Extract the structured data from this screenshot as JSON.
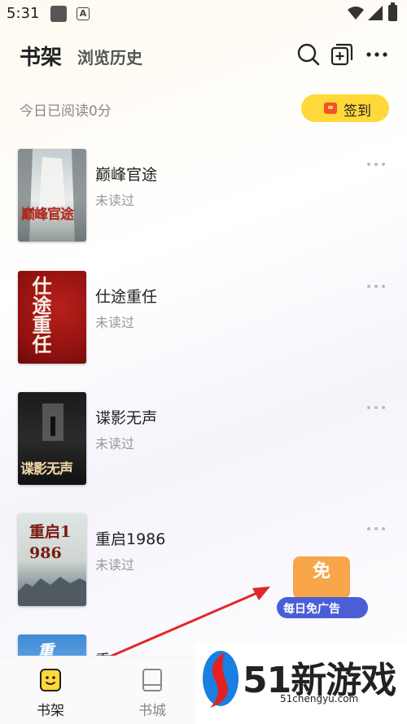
{
  "status_bar": {
    "time": "5:31",
    "a_badge": "A"
  },
  "header": {
    "title": "书架",
    "history_tab": "浏览历史",
    "icons": [
      "search-icon",
      "add-icon",
      "more-icon"
    ]
  },
  "reading": {
    "today": "今日已阅读0分"
  },
  "signin": {
    "label": "签到",
    "color": "#ffd83a"
  },
  "books": [
    {
      "title": "巅峰官途",
      "status": "未读过",
      "cover_text": "巅峰官途"
    },
    {
      "title": "仕途重任",
      "status": "未读过",
      "cover_text": "仕途重任"
    },
    {
      "title": "谍影无声",
      "status": "未读过",
      "cover_text": "谍影无声"
    },
    {
      "title": "重启1986",
      "status": "未读过",
      "cover_text": "重启1986"
    },
    {
      "title": "重",
      "status": "",
      "cover_text": "重"
    }
  ],
  "free_ad": {
    "char": "免",
    "label": "每日免广告",
    "color": "#4a5fd6"
  },
  "bottom_nav": [
    {
      "label": "书架",
      "icon": "bookshelf-icon",
      "active": true
    },
    {
      "label": "书城",
      "icon": "book-icon",
      "active": false
    }
  ],
  "watermark": {
    "text": "51新游戏",
    "url": "51chengyu.com"
  },
  "colors": {
    "accent": "#ffd83a",
    "arrow": "#e0282a",
    "nav_active": "#ffd83a"
  }
}
